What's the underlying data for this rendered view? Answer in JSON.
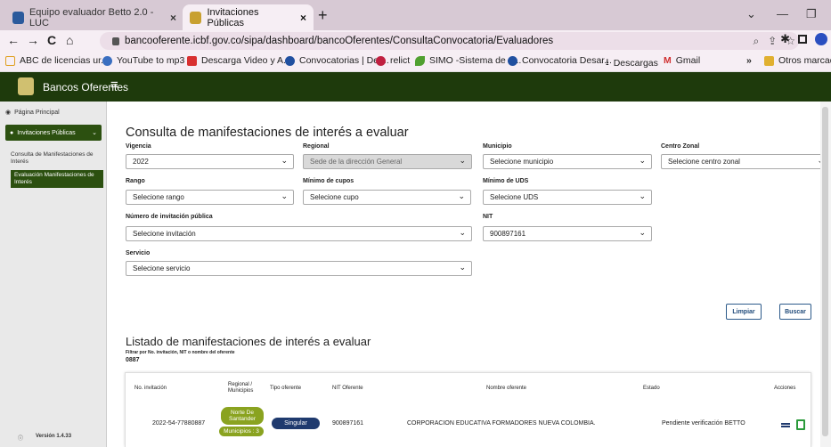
{
  "browser": {
    "tabs": [
      {
        "label": "Equipo evaluador Betto 2.0 - LUC",
        "close": "×",
        "active": false
      },
      {
        "label": "Invitaciones Públicas",
        "close": "×",
        "active": true
      }
    ],
    "new_tab": "+",
    "window_controls": [
      "⌄",
      "—",
      "❐"
    ],
    "url": "bancooferente.icbf.gov.co/sipa/dashboard/bancoOferentes/ConsultaConvocatoria/Evaluadores",
    "nav": {
      "back": "←",
      "forward": "→",
      "reload": "C",
      "home": "⌂"
    },
    "bookmarks": [
      {
        "label": "ABC de licencias ur...",
        "icon": "square-icon",
        "color": "#e0a020"
      },
      {
        "label": "YouTube to mp3",
        "icon": "cloud-icon",
        "color": "#3a6ec0"
      },
      {
        "label": "Descarga Video y A...",
        "icon": "download-icon",
        "color": "#d83030"
      },
      {
        "label": "Convocatorias | Def...",
        "icon": "globe-icon",
        "color": "#2050a0"
      },
      {
        "label": "relict",
        "icon": "circle-icon",
        "color": "#c02040"
      },
      {
        "label": "SIMO -Sistema de a...",
        "icon": "leaf-icon",
        "color": "#50a030"
      },
      {
        "label": "Convocatoria Desar...",
        "icon": "globe-icon",
        "color": "#2050a0"
      },
      {
        "label": "Descargas",
        "icon": "download-icon",
        "color": "#333333"
      },
      {
        "label": "Gmail",
        "icon": "gmail-icon",
        "color": "#d03030"
      },
      {
        "label": "»",
        "icon": "more-icon",
        "color": "#333333"
      },
      {
        "label": "Otros marcado",
        "icon": "folder-icon",
        "color": "#e0b030"
      }
    ]
  },
  "app": {
    "title": "Bancos Oferentes",
    "menu_icon": "≡"
  },
  "sidebar": {
    "home": "Página Principal",
    "group": "Invitaciones Públicas",
    "items": [
      "Consulta de Manifestaciones de Interés",
      "Evaluación Manifestaciones de Interés"
    ],
    "footer_icon": "ⓘ",
    "version": "Versión 1.4.33"
  },
  "form": {
    "title": "Consulta de manifestaciones de interés a evaluar",
    "fields": {
      "vigencia": {
        "label": "Vigencia",
        "value": "2022"
      },
      "regional": {
        "label": "Regional",
        "value": "Sede de la dirección General"
      },
      "municipio": {
        "label": "Municipio",
        "value": "Selecione municipio"
      },
      "centro_zonal": {
        "label": "Centro Zonal",
        "value": "Selecione centro zonal"
      },
      "rango": {
        "label": "Rango",
        "value": "Selecione rango"
      },
      "minimo_cupos": {
        "label": "Mínimo de cupos",
        "value": "Selecione cupo"
      },
      "minimo_uds": {
        "label": "Mínimo de UDS",
        "value": "Selecione UDS"
      },
      "invitacion": {
        "label": "Número de invitación pública",
        "value": "Selecione invitación"
      },
      "nit": {
        "label": "NIT",
        "value": "900897161"
      },
      "servicio": {
        "label": "Servicio",
        "value": "Selecione servicio"
      }
    },
    "chevron": "⌄",
    "buttons": {
      "clear": "Limpiar",
      "search": "Buscar"
    }
  },
  "listing": {
    "title": "Listado de manifestaciones de interés a evaluar",
    "filter_label": "Filtrar por No. invitación, NIT o nombre del oferente",
    "filter_value": "0887",
    "columns": [
      "No. invitación",
      "Regional / Municipios",
      "Tipo oferente",
      "NIT Oferente",
      "Nombre oferente",
      "Estado",
      "Acciones"
    ],
    "rows": [
      {
        "invitation": "2022-54-77880887",
        "regional": "Norte De Santander",
        "municipios": "Municipios : 3",
        "tipo": "Singular",
        "nit": "900897161",
        "nombre": "CORPORACION EDUCATIVA FORMADORES NUEVA COLOMBIA.",
        "estado": "Pendiente verificación BETTO"
      }
    ]
  },
  "colors": {
    "header": "#1e3a0c",
    "sidebar_active": "#2c5010",
    "pill_regional": "#8aa320",
    "pill_tipo": "#1f3a6e",
    "action_green": "#2a9a3a"
  }
}
